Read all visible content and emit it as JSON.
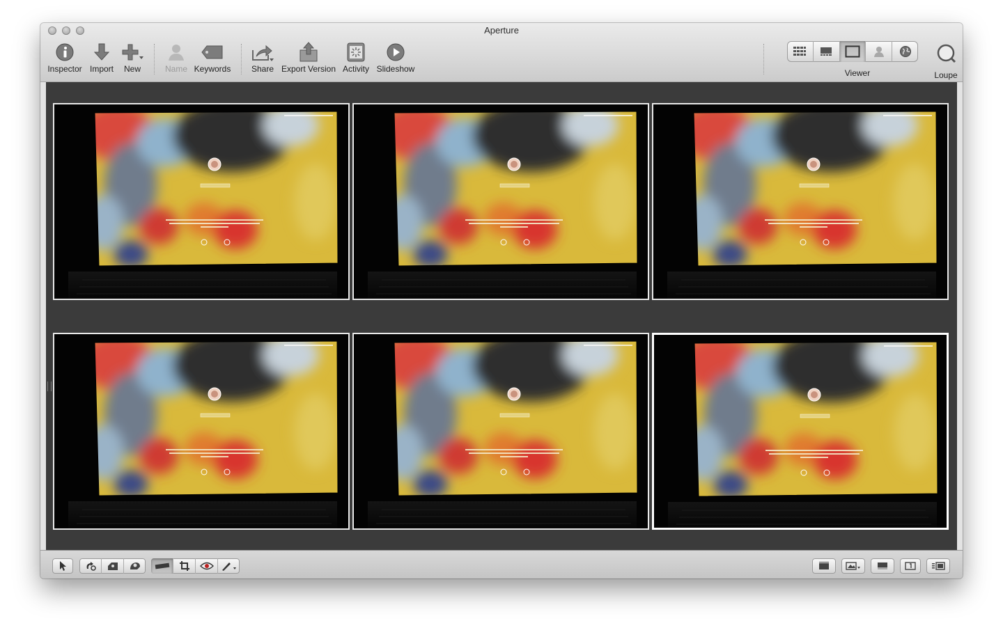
{
  "window": {
    "title": "Aperture"
  },
  "toolbar": {
    "inspector": "Inspector",
    "import": "Import",
    "new": "New",
    "name": "Name",
    "keywords": "Keywords",
    "share": "Share",
    "export_version": "Export Version",
    "activity": "Activity",
    "slideshow": "Slideshow",
    "viewer": "Viewer",
    "loupe": "Loupe"
  },
  "viewer_modes": [
    "grid-view-icon",
    "filmstrip-view-icon",
    "viewer-only-icon",
    "faces-icon",
    "places-icon"
  ],
  "active_viewer_mode": "viewer-only-icon",
  "photos": [
    {
      "id": 1,
      "selected": false
    },
    {
      "id": 2,
      "selected": false
    },
    {
      "id": 3,
      "selected": false
    },
    {
      "id": 4,
      "selected": false
    },
    {
      "id": 5,
      "selected": false
    },
    {
      "id": 6,
      "selected": true
    }
  ],
  "bottom_tools": [
    "pointer-icon",
    "rotate-icon",
    "straighten-icon",
    "lift-stamp-icon",
    "quick-brush-icon",
    "crop-icon",
    "red-eye-icon",
    "brush-icon"
  ],
  "colors": {
    "content_bg": "#3b3b3b",
    "selection_border": "#ffffff",
    "titlebar": "#d6d6d6"
  }
}
